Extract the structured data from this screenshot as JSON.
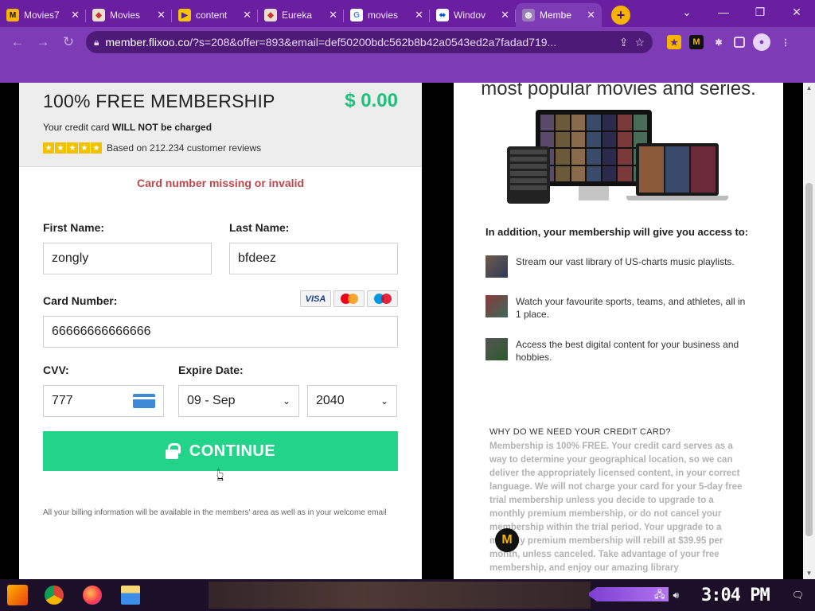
{
  "browser": {
    "tabs": [
      {
        "title": "Movies7",
        "fav_bg": "#f5b400",
        "fav_fg": "#111",
        "fav_glyph": "M"
      },
      {
        "title": "Movies",
        "fav_bg": "#e9e0d0",
        "fav_fg": "#c33",
        "fav_glyph": "◆"
      },
      {
        "title": "content",
        "fav_bg": "#f5c400",
        "fav_fg": "#5a2a8a",
        "fav_glyph": "▶"
      },
      {
        "title": "Eureka",
        "fav_bg": "#e9e0d0",
        "fav_fg": "#c33",
        "fav_glyph": "◆"
      },
      {
        "title": "movies",
        "fav_bg": "#fff",
        "fav_fg": "#4285f4",
        "fav_glyph": "G"
      },
      {
        "title": "Windov",
        "fav_bg": "#fff",
        "fav_fg": "#0057d8",
        "fav_glyph": "⬌"
      },
      {
        "title": "Membe",
        "fav_bg": "#9a7cb8",
        "fav_fg": "#fff",
        "fav_glyph": "◍",
        "active": true
      }
    ],
    "new_tab_glyph": "+",
    "window_controls": [
      "⌄",
      "—",
      "❐",
      "✕"
    ],
    "url_host": "member.flixoo.co",
    "url_rest": "/?s=208&offer=893&email=def50200bdc562b8b42a0543ed2a7fadad719...",
    "colors": {
      "frame": "#6a1ea0",
      "toolbar": "#7d3bb5",
      "omnibox": "#4e1a78"
    }
  },
  "offer": {
    "title": "100% FREE MEMBERSHIP",
    "price": "$ 0.00",
    "charge_prefix": "Your credit card ",
    "charge_bold": "WILL NOT be charged",
    "reviews": "Based on 212.234 customer reviews",
    "stars": 5
  },
  "form": {
    "error": "Card number missing or invalid",
    "first_name_label": "First Name:",
    "first_name_value": "zongly",
    "last_name_label": "Last Name:",
    "last_name_value": "bfdeez",
    "card_label": "Card Number:",
    "card_brands": [
      "VISA",
      "Mastercard",
      "Maestro"
    ],
    "card_value": "66666666666666",
    "cvv_label": "CVV:",
    "cvv_value": "777",
    "expire_label": "Expire Date:",
    "expire_month": "09 - Sep",
    "expire_year": "2040",
    "continue_label": "CONTINUE",
    "billing_note": "All your billing information will be available in the members' area as well as in your welcome email",
    "accent": "#22d38a",
    "error_color": "#c0474b"
  },
  "right": {
    "heading": "most popular movies and series.",
    "addition": "In addition, your membership will give you access to:",
    "features": [
      "Stream our vast library of US-charts music playlists.",
      "Watch your favourite sports, teams, and athletes, all in 1 place.",
      "Access the best digital content for your business and hobbies."
    ],
    "why_title": "WHY DO WE NEED YOUR CREDIT CARD?",
    "why_text": "Membership is 100% FREE. Your credit card serves as a way to determine your geographical location, so we can deliver the appropriately licensed content, in your correct language. We will not charge your card for your 5-day free trial membership unless you decide to upgrade to a monthly premium membership, or do not cancel your membership within the trial period. Your upgrade to a monthly premium membership will rebill at $39.95 per month, unless canceled. Take advantage of your free membership, and enjoy our amazing library",
    "badge_glyph": "M"
  },
  "taskbar": {
    "clock": "3:04 PM",
    "apps": [
      "chrome-icon",
      "firefox-icon",
      "file-explorer-icon"
    ]
  }
}
